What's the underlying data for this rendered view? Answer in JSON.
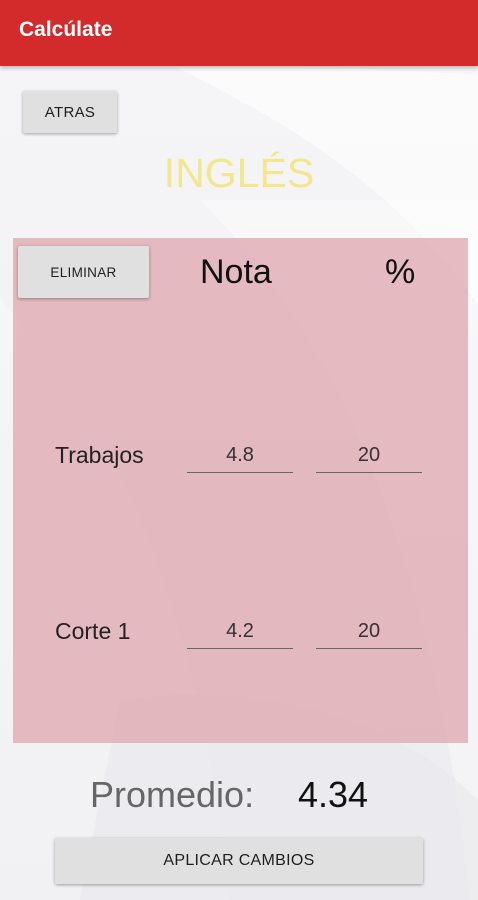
{
  "app": {
    "title": "Calcúlate"
  },
  "toolbar": {
    "back_label": "ATRAS"
  },
  "subject": {
    "title": "INGLÉS"
  },
  "grades_table": {
    "delete_label": "ELIMINAR",
    "columns": {
      "grade": "Nota",
      "percent": "%"
    },
    "rows": [
      {
        "name": "Trabajos",
        "grade": "4.8",
        "percent": "20"
      },
      {
        "name": "Corte 1",
        "grade": "4.2",
        "percent": "20"
      }
    ]
  },
  "summary": {
    "average_label": "Promedio:",
    "average_value": "4.34"
  },
  "actions": {
    "apply_label": "APLICAR CAMBIOS"
  },
  "colors": {
    "appbar": "#d32b2b",
    "panel": "#dea2ab",
    "subject_title": "#f3e68f"
  }
}
